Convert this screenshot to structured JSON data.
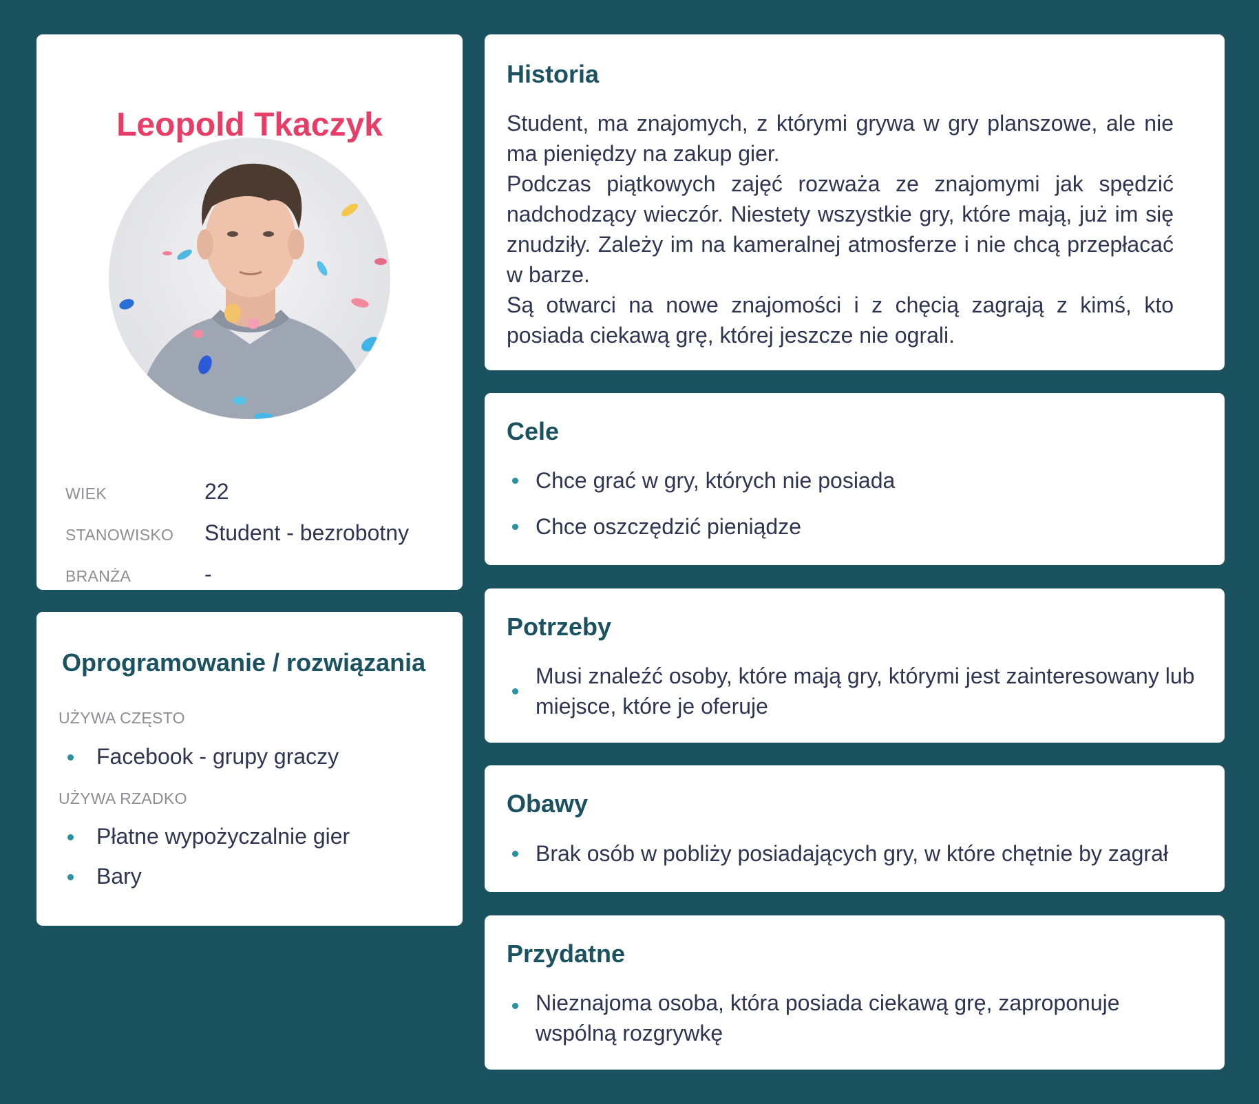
{
  "profile": {
    "name": "Leopold Tkaczyk",
    "fields": [
      {
        "label": "WIEK",
        "value": "22"
      },
      {
        "label": "STANOWISKO",
        "value": "Student - bezrobotny"
      },
      {
        "label": "BRANŻA",
        "value": "-"
      }
    ],
    "photo": "portrait-photo"
  },
  "software": {
    "title": "Oprogramowanie / rozwiązania",
    "often_label": "UŻYWA CZĘSTO",
    "often_items": [
      "Facebook - grupy graczy"
    ],
    "rarely_label": "UŻYWA RZADKO",
    "rarely_items": [
      "Płatne wypożyczalnie gier",
      "Bary"
    ]
  },
  "history": {
    "title": "Historia",
    "paragraphs": [
      "Student, ma znajomych, z którymi grywa w gry planszowe, ale nie ma pieniędzy na zakup gier.",
      "Podczas piątkowych zajęć rozważa ze znajomymi jak spędzić nadchodzący wieczór. Niestety wszystkie gry, które mają, już im się znudziły. Zależy im na kameralnej atmosferze i nie chcą przepłacać w barze.",
      "Są otwarci na nowe znajomości i z chęcią zagrają z kimś, kto posiada ciekawą grę, której jeszcze nie ograli."
    ]
  },
  "goals": {
    "title": "Cele",
    "items": [
      "Chce grać w gry, których nie posiada",
      "Chce oszczędzić pieniądze"
    ]
  },
  "needs": {
    "title": "Potrzeby",
    "items": [
      "Musi znaleźć osoby, które mają gry, którymi jest zainteresowany lub miejsce, które je oferuje"
    ]
  },
  "concerns": {
    "title": "Obawy",
    "items": [
      "Brak osób w pobliży posiadających gry, w które chętnie by zagrał"
    ]
  },
  "useful": {
    "title": "Przydatne",
    "items": [
      "Nieznajoma osoba, która posiada ciekawą grę, zaproponuje wspólną rozgrywkę"
    ]
  },
  "colors": {
    "background": "#1b5260",
    "accent_name": "#e63e67",
    "heading": "#1b5260",
    "text": "#2e3550",
    "label": "#8d8d95",
    "bullet": "#2a8f9e"
  }
}
